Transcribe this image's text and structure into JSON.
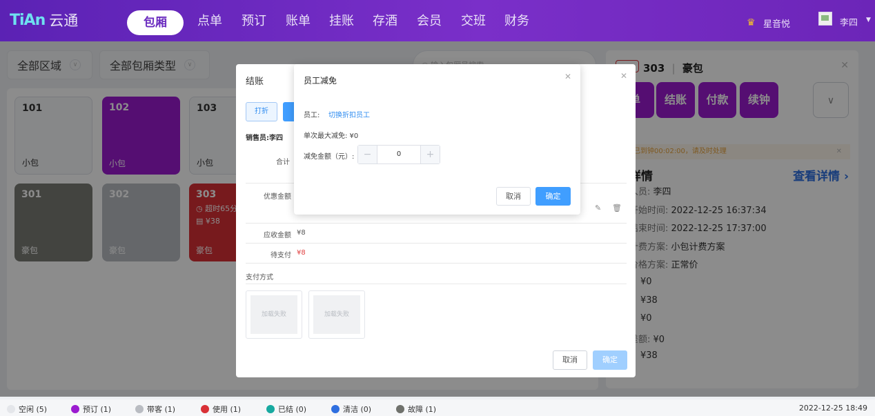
{
  "brand": {
    "logo_mark": "TiAn",
    "name": "云通"
  },
  "nav": {
    "active": "包厢",
    "items": [
      "点单",
      "预订",
      "账单",
      "挂账",
      "存酒",
      "会员",
      "交班",
      "财务"
    ]
  },
  "header": {
    "store": "星音悦",
    "user": "李四"
  },
  "filters": {
    "area": "全部区域",
    "room_type": "全部包厢类型",
    "search_placeholder": "输入包厢号搜索"
  },
  "rooms": [
    {
      "num": "101",
      "type": "小包",
      "status": "idle"
    },
    {
      "num": "102",
      "type": "小包",
      "status": "book"
    },
    {
      "num": "103",
      "type": "小包",
      "status": "idle"
    },
    {
      "num": "301",
      "type": "豪包",
      "status": "broken"
    },
    {
      "num": "302",
      "type": "豪包",
      "status": "guest"
    },
    {
      "num": "303",
      "type": "豪包",
      "status": "inuse",
      "overtime": "超时65分",
      "amount": "¥38"
    }
  ],
  "detail": {
    "room_num": "303",
    "room_type": "豪包",
    "buttons": [
      "单",
      "结账",
      "付款",
      "续钟"
    ],
    "warning": "已到钟00:02:00，请及时处理",
    "section_title": "详情",
    "view_detail": "查看详情",
    "fields": [
      {
        "k": "人员:",
        "v": "李四"
      },
      {
        "k": "开始时间:",
        "v": "2022-12-25 16:37:34"
      },
      {
        "k": "结束时间:",
        "v": "2022-12-25 17:37:00"
      },
      {
        "k": "计费方案:",
        "v": "小包计费方案"
      },
      {
        "k": "价格方案:",
        "v": "正常价"
      },
      {
        "k": "",
        "v": "¥0"
      },
      {
        "k": "",
        "v": "¥38"
      },
      {
        "k": "",
        "v": "¥0"
      },
      {
        "k": "差额:",
        "v": "¥0"
      },
      {
        "k": "",
        "v": "¥38"
      }
    ]
  },
  "settle": {
    "title": "结账",
    "discount_btn": "打折",
    "seller": "销售员:李四",
    "total_label": "合计",
    "promo_label": "优惠金额",
    "receivable_label": "应收金额",
    "receivable_value": "¥8",
    "pending_label": "待支付",
    "pending_value": "¥8",
    "pay_method_label": "支付方式",
    "pay_tiles": [
      "加载失败",
      "加载失败"
    ],
    "cancel": "取消",
    "ok": "确定"
  },
  "discount_dialog": {
    "title": "员工减免",
    "staff_label": "员工:",
    "switch_staff": "切换折扣员工",
    "max_label": "单次最大减免: ¥0",
    "amount_label": "减免金额（元）:",
    "amount_value": "0",
    "minus": "−",
    "plus": "+",
    "cancel": "取消",
    "ok": "确定"
  },
  "legend": [
    {
      "label": "空闲 (5)",
      "color": "#e4e6ea"
    },
    {
      "label": "预订 (1)",
      "color": "#9b1bd0"
    },
    {
      "label": "带客 (1)",
      "color": "#b9bcc2"
    },
    {
      "label": "使用 (1)",
      "color": "#d93036"
    },
    {
      "label": "已结 (0)",
      "color": "#17a9a0"
    },
    {
      "label": "清洁 (0)",
      "color": "#2f6fe0"
    },
    {
      "label": "故障 (1)",
      "color": "#6f716c"
    }
  ],
  "clock": "2022-12-25 18:49"
}
